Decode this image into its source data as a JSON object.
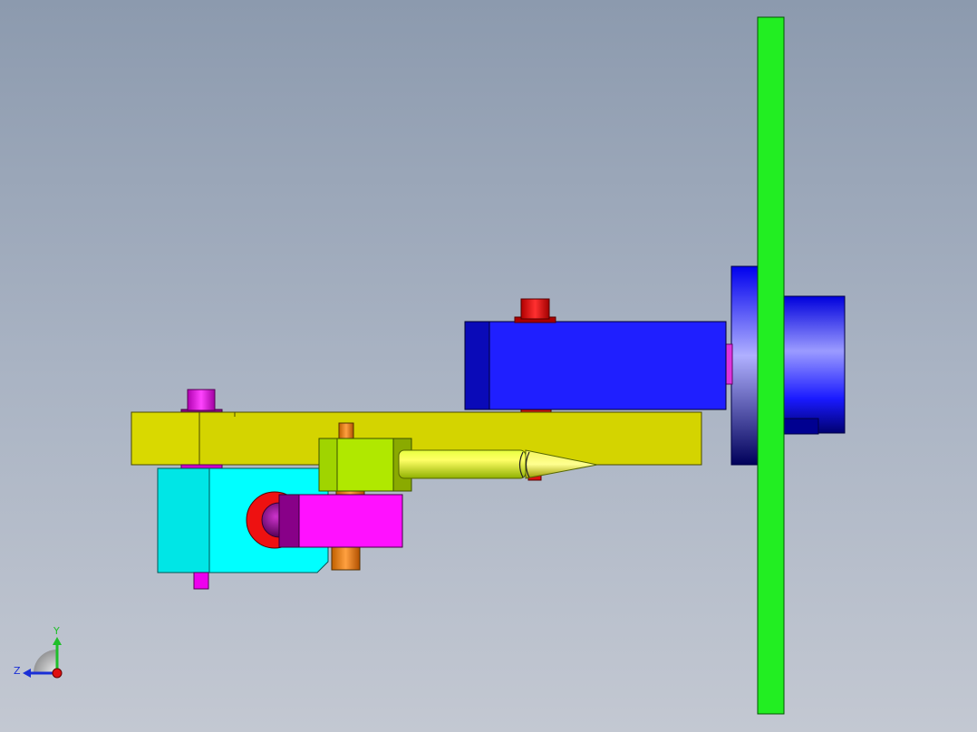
{
  "viewport": {
    "background_top": "#8c9aae",
    "background_bottom": "#c3c8d2"
  },
  "triad": {
    "y_label": "Y",
    "z_label": "Z",
    "y_color": "#1fbf2a",
    "z_color": "#1a2fd6",
    "x_color": "#e01010"
  },
  "parts": {
    "plate_color": "#22ee22",
    "motor_color": "#1a1aff",
    "arm_color": "#d4d400",
    "bracket_color": "#00ffff",
    "pin_color": "#ee00ee",
    "nut_color": "#ee1111",
    "shaft_color": "#ff8c1a",
    "slider_color": "#b0e800",
    "roller_color": "#ff11ff"
  }
}
